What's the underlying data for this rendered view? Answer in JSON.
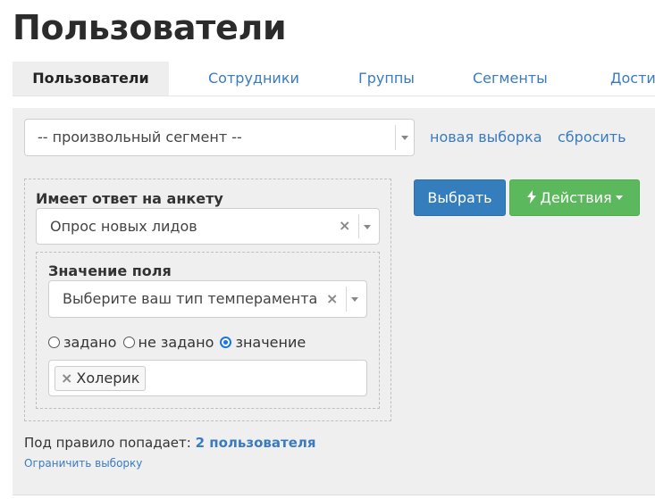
{
  "page": {
    "title": "Пользователи"
  },
  "tabs": [
    {
      "label": "Пользователи",
      "active": true
    },
    {
      "label": "Сотрудники"
    },
    {
      "label": "Группы"
    },
    {
      "label": "Сегменты"
    },
    {
      "label": "Дости"
    }
  ],
  "segment": {
    "value": "-- произвольный сегмент --",
    "new_selection_link": "новая выборка",
    "reset_link": "сбросить"
  },
  "rule": {
    "label": "Имеет ответ на анкету",
    "survey_value": "Опрос новых лидов",
    "field": {
      "label": "Значение поля",
      "value": "Выберите ваш тип темперамента",
      "radios": [
        {
          "label": "задано",
          "checked": false
        },
        {
          "label": "не задано",
          "checked": false
        },
        {
          "label": "значение",
          "checked": true
        }
      ],
      "tags": [
        "Холерик"
      ]
    }
  },
  "actions": {
    "select_label": "Выбрать",
    "actions_label": "Действия",
    "select_color": "#357ebd",
    "actions_color": "#5cb85c"
  },
  "summary": {
    "prefix": "Под правило попадает:",
    "count": "2 пользователя",
    "limit_link": "Ограничить выборку"
  },
  "icons": {
    "clear": "clear-x-icon",
    "caret": "caret-down-icon",
    "bolt": "lightning-icon"
  }
}
